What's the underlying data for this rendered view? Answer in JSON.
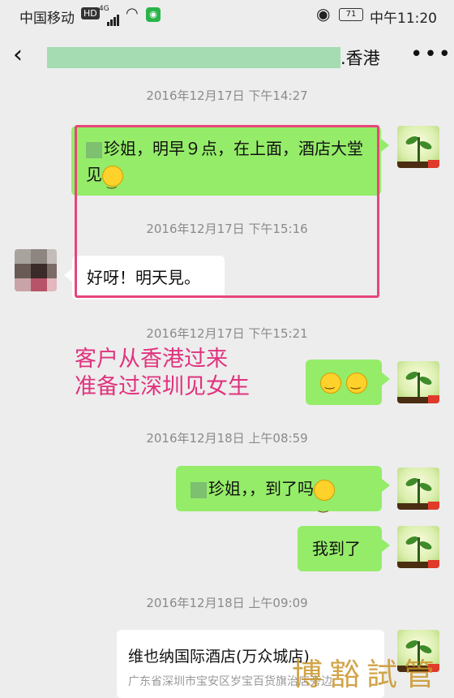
{
  "status_bar": {
    "carrier": "中国移动",
    "hd_badge": "HD",
    "network": "4G",
    "battery": "71",
    "time": "中午11:20"
  },
  "nav": {
    "back_icon": "chevron-left-icon",
    "title_suffix": ".香港",
    "more_icon": "ellipsis-icon"
  },
  "messages": {
    "ts1": "2016年12月17日 下午14:27",
    "m1_text": "珍姐，明早９点，在上面，酒店大堂见",
    "ts2": "2016年12月17日 下午15:16",
    "m2_text": "好呀！明天見。",
    "ts3": "2016年12月17日 下午15:21",
    "ts4": "2016年12月18日 上午08:59",
    "m4_text": "珍姐，，到了吗",
    "m5_text": "我到了",
    "ts5": "2016年12月18日 上午09:09",
    "location_name": "维也纳国际酒店(万众城店)",
    "location_address": "广东省深圳市宝安区岁宝百货旗治店旁边"
  },
  "annotation": {
    "line1": "客户从香港过来",
    "line2": "准备过深圳见女生"
  },
  "watermark": "博豁試管",
  "colors": {
    "chat_bg": "#ededed",
    "my_bubble": "#95ec69",
    "their_bubble": "#ffffff",
    "highlight": "#e7457a",
    "annotation": "#e0337e"
  }
}
